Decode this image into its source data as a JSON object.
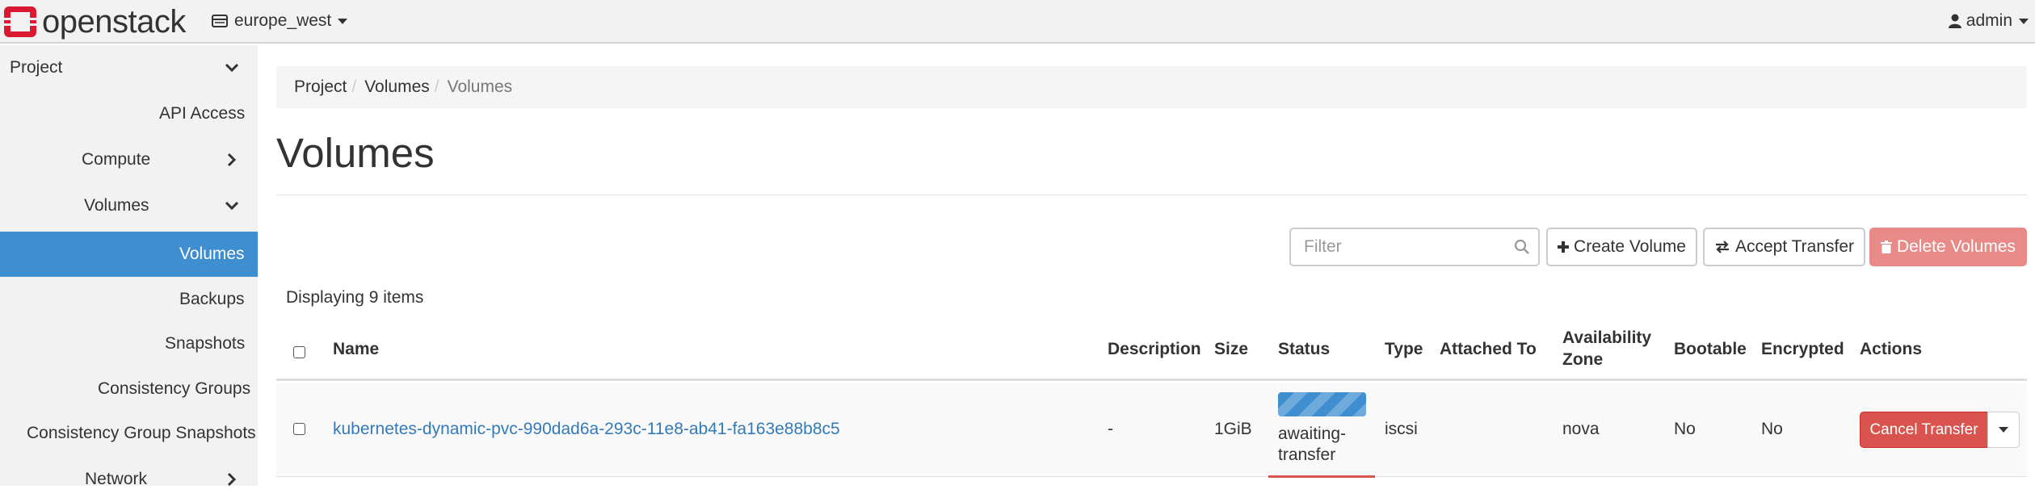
{
  "brand": {
    "name": "openstack",
    "color": "#da1a32"
  },
  "header": {
    "region": "europe_west",
    "user": "admin"
  },
  "sidebar": {
    "items": [
      {
        "label": "Project",
        "chevron": "chevron-down-icon"
      },
      {
        "label": "API Access"
      },
      {
        "label": "Compute",
        "chevron": "chevron-right-icon"
      },
      {
        "label": "Volumes",
        "chevron": "chevron-down-icon"
      },
      {
        "label": "Volumes",
        "active": true
      },
      {
        "label": "Backups"
      },
      {
        "label": "Snapshots"
      },
      {
        "label": "Consistency Groups"
      },
      {
        "label": "Consistency Group Snapshots"
      },
      {
        "label": "Network",
        "chevron": "chevron-right-icon"
      }
    ],
    "active_color": "#3e8ed0"
  },
  "breadcrumb": [
    "Project",
    "Volumes",
    "Volumes"
  ],
  "page_title": "Volumes",
  "toolbar": {
    "filter_placeholder": "Filter",
    "create_label": "Create Volume",
    "accept_label": "Accept Transfer",
    "delete_label": "Delete Volumes"
  },
  "displaying": "Displaying 9 items",
  "table": {
    "columns": [
      "Name",
      "Description",
      "Size",
      "Status",
      "Type",
      "Attached To",
      "Availability Zone",
      "Bootable",
      "Encrypted",
      "Actions"
    ],
    "rows": [
      {
        "name": "kubernetes-dynamic-pvc-990dad6a-293c-11e8-ab41-fa163e88b8c5",
        "description": "-",
        "size": "1GiB",
        "status_line1": "awaiting-",
        "status_line2": "transfer",
        "type": "iscsi",
        "attached_to": "",
        "availability_zone": "nova",
        "bootable": "No",
        "encrypted": "No",
        "action": "Cancel Transfer"
      }
    ]
  },
  "colors": {
    "link": "#337ab7",
    "danger": "#d9534f",
    "danger_disabled": "#e88a88"
  }
}
